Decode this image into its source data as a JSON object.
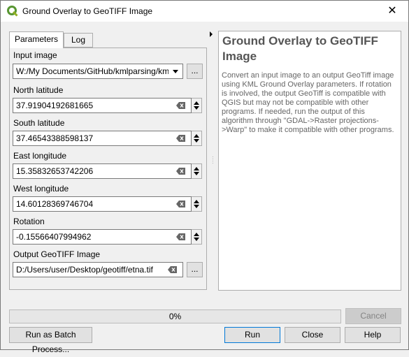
{
  "window": {
    "title": "Ground Overlay to GeoTIFF Image",
    "close_glyph": "✕",
    "icon": "qgis-icon"
  },
  "tabs": [
    {
      "label": "Parameters"
    },
    {
      "label": "Log"
    }
  ],
  "params": {
    "input_image": {
      "label": "Input image",
      "value": "W:/My Documents/GitHub/kmlparsing/kml-sar",
      "browse": "..."
    },
    "north_latitude": {
      "label": "North latitude",
      "value": "37.91904192681665"
    },
    "south_latitude": {
      "label": "South latitude",
      "value": "37.46543388598137"
    },
    "east_longitude": {
      "label": "East longitude",
      "value": "15.35832653742206"
    },
    "west_longitude": {
      "label": "West longitude",
      "value": "14.60128369746704"
    },
    "rotation": {
      "label": "Rotation",
      "value": "-0.15566407994962"
    },
    "output": {
      "label": "Output GeoTIFF Image",
      "value": "D:/Users/user/Desktop/geotiff/etna.tif",
      "browse": "..."
    }
  },
  "help": {
    "title": "Ground Overlay to GeoTIFF Image",
    "body": "Convert an input image to an output GeoTiff image using KML Ground Overlay parameters. If rotation is involved, the output GeoTiff is compatible with QGIS but may not be compatible with other programs. If needed, run the output of this algorithm through \"GDAL->Raster projections->Warp\" to make it compatible with other programs."
  },
  "progress": {
    "value": 0,
    "text": "0%"
  },
  "buttons": {
    "cancel": "Cancel",
    "batch": "Run as Batch Process...",
    "run": "Run",
    "close": "Close",
    "help": "Help"
  }
}
